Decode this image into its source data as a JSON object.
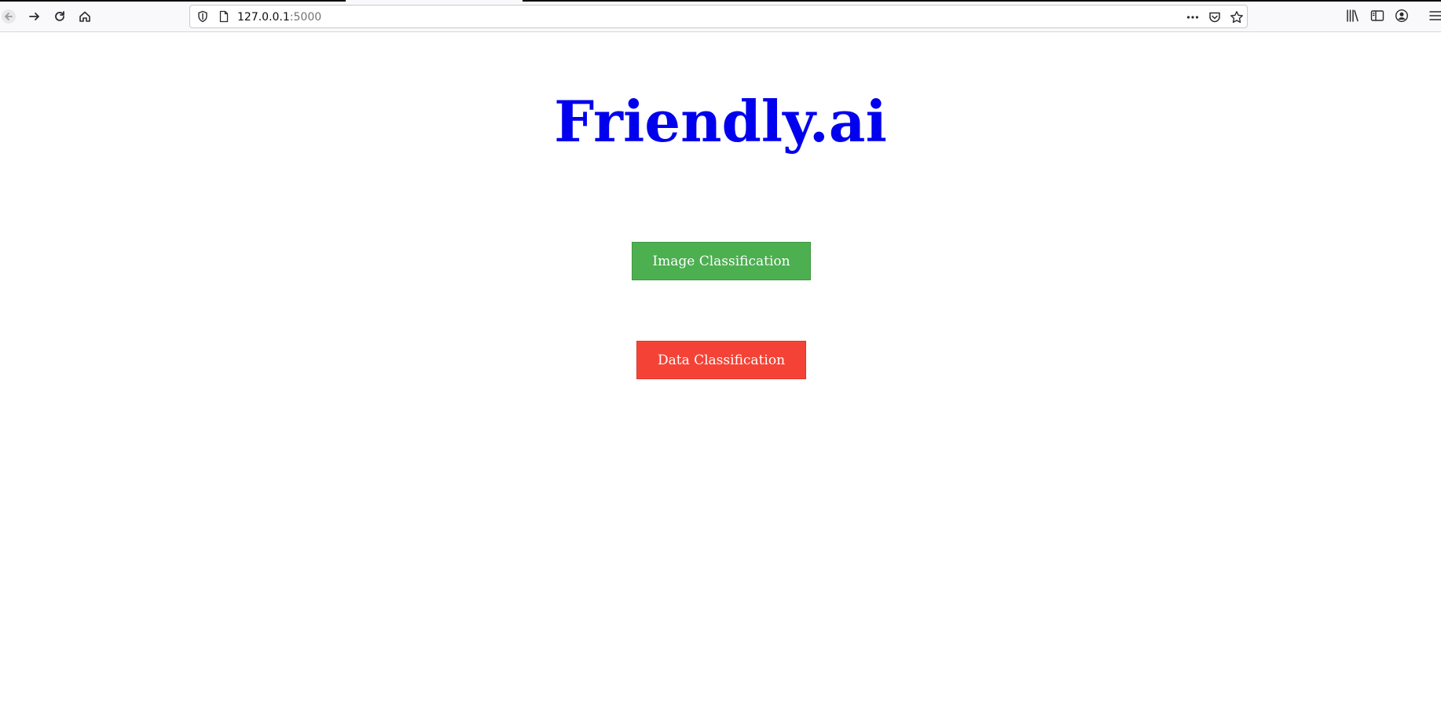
{
  "browser": {
    "url_host": "127.0.0.1",
    "url_port": ":5000",
    "icons": {
      "back": "back-arrow-icon",
      "forward": "forward-arrow-icon",
      "reload": "reload-icon",
      "home": "home-icon",
      "tracking": "shield-icon",
      "page": "page-icon",
      "more": "more-dots-icon",
      "pocket": "pocket-icon",
      "bookmark": "star-icon",
      "library": "library-icon",
      "sidebar": "sidebar-icon",
      "account": "account-icon",
      "menu": "hamburger-menu-icon"
    }
  },
  "page": {
    "title": "Friendly.ai",
    "title_color": "#0000ee",
    "buttons": {
      "image_classification": {
        "label": "Image Classification",
        "color": "#4caf50"
      },
      "data_classification": {
        "label": "Data Classification",
        "color": "#f44336"
      }
    }
  }
}
